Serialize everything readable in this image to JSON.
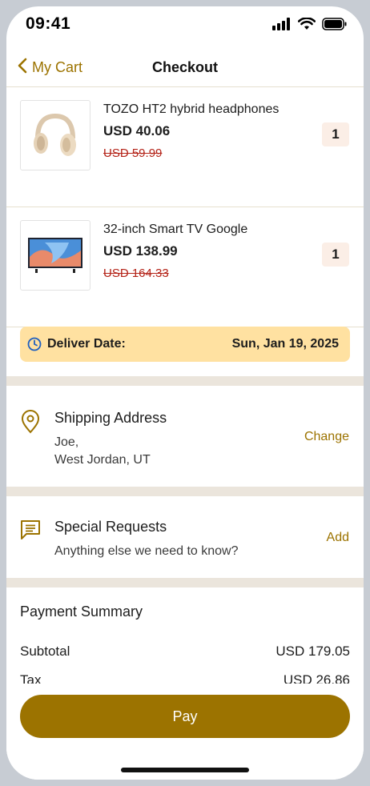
{
  "status_bar": {
    "time": "09:41"
  },
  "nav": {
    "back_label": "My Cart",
    "title": "Checkout"
  },
  "items": [
    {
      "name": "TOZO HT2 hybrid headphones",
      "price": "USD 40.06",
      "original_price": "USD 59.99",
      "quantity": "1",
      "image": "headphones-image"
    },
    {
      "name": "32-inch Smart TV Google",
      "price": "USD 138.99",
      "original_price": "USD 164.33",
      "quantity": "1",
      "image": "tv-image"
    }
  ],
  "delivery": {
    "label": "Deliver Date:",
    "date": "Sun, Jan 19, 2025",
    "icon": "clock-icon"
  },
  "shipping": {
    "title": "Shipping Address",
    "name": "Joe,",
    "location": "West Jordan, UT",
    "action": "Change",
    "icon": "location-pin-icon"
  },
  "requests": {
    "title": "Special Requests",
    "subtitle": "Anything else we need to know?",
    "action": "Add",
    "icon": "message-icon"
  },
  "payment_summary": {
    "title": "Payment Summary",
    "rows": [
      {
        "label": "Subtotal",
        "value": "USD 179.05"
      },
      {
        "label": "Tax",
        "value": "USD 26.86"
      }
    ]
  },
  "pay_button": {
    "label": "Pay"
  },
  "colors": {
    "accent": "#9C7300",
    "strike": "#B42318",
    "delivery_bg": "#FFE1A1",
    "qty_bg": "#FBEEE6"
  }
}
